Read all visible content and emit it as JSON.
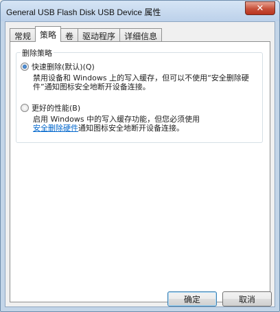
{
  "window": {
    "title": "General USB Flash Disk USB Device 属性",
    "close_label": "✕"
  },
  "tabs": [
    {
      "label": "常规"
    },
    {
      "label": "策略"
    },
    {
      "label": "卷"
    },
    {
      "label": "驱动程序"
    },
    {
      "label": "详细信息"
    }
  ],
  "policy": {
    "group_label": "删除策略",
    "quick": {
      "label": "快速删除(默认)(Q)",
      "desc": "禁用设备和 Windows 上的写入缓存，但可以不使用“安全删除硬件”通知图标安全地断开设备连接。",
      "checked": true
    },
    "performance": {
      "label": "更好的性能(B)",
      "desc_prefix": "启用 Windows 中的写入缓存功能，但您必须使用",
      "link": "安全删除硬件",
      "desc_suffix": "通知图标安全地断开设备连接。",
      "checked": false
    }
  },
  "buttons": {
    "ok": "确定",
    "cancel": "取消"
  }
}
